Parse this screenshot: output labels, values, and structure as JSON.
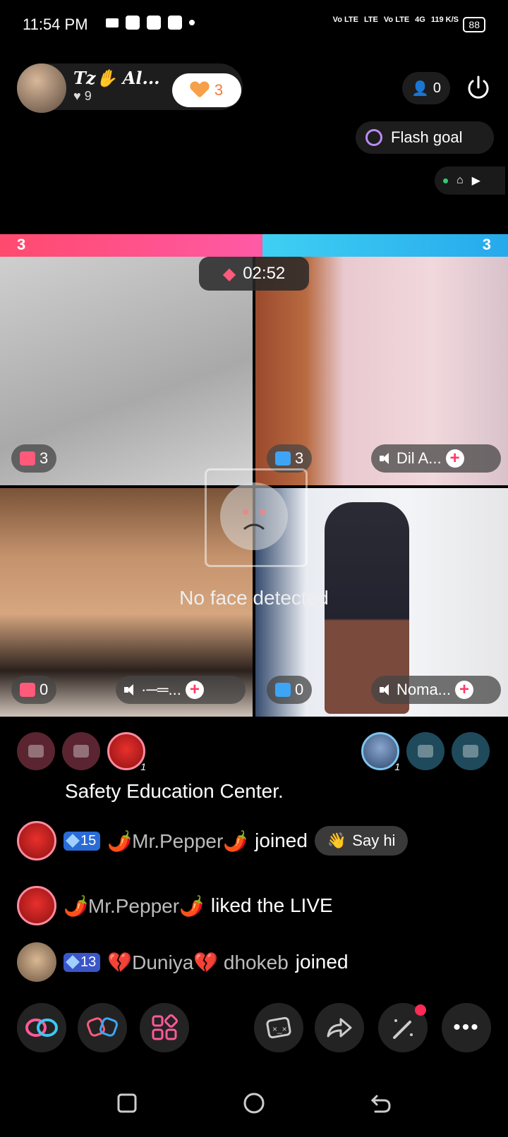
{
  "status_bar": {
    "time": "11:54 PM",
    "network": [
      "Vo LTE",
      "LTE",
      "Vo LTE",
      "4G"
    ],
    "speed": "119 K/S",
    "battery": "88"
  },
  "host": {
    "name": "Tz✋ Al...",
    "likes": "9",
    "follow_count": "3"
  },
  "viewers": {
    "count": "0"
  },
  "flash_goal": {
    "label": "Flash goal"
  },
  "battle": {
    "score_left": "3",
    "score_right": "3",
    "timer": "02:52"
  },
  "tiles": [
    {
      "gift_count": "3",
      "gift_color": "#ff5a7a"
    },
    {
      "gift_count": "3",
      "gift_color": "#3ea5f5",
      "name": "Dil A..."
    },
    {
      "gift_count": "0",
      "gift_color": "#ff5a7a",
      "name": "·─═..."
    },
    {
      "gift_count": "0",
      "gift_color": "#3ea5f5",
      "name": "Noma..."
    }
  ],
  "overlay": {
    "no_face": "No face detected"
  },
  "seats": {
    "pepper_badge": "1",
    "man_badge": "1"
  },
  "chat": {
    "system": "Safety Education Center.",
    "messages": [
      {
        "level": "15",
        "user": "🌶️Mr.Pepper🌶️",
        "action": "joined",
        "button": "Say hi"
      },
      {
        "user": "🌶️Mr.Pepper🌶️",
        "action": "liked the LIVE"
      },
      {
        "level": "13",
        "user": "💔Duniya💔 dhokeb",
        "action": "joined"
      }
    ]
  },
  "colors": {
    "accent_pink": "#ff4a6e",
    "accent_blue": "#26a9ec",
    "follow_orange": "#f17b3a"
  }
}
